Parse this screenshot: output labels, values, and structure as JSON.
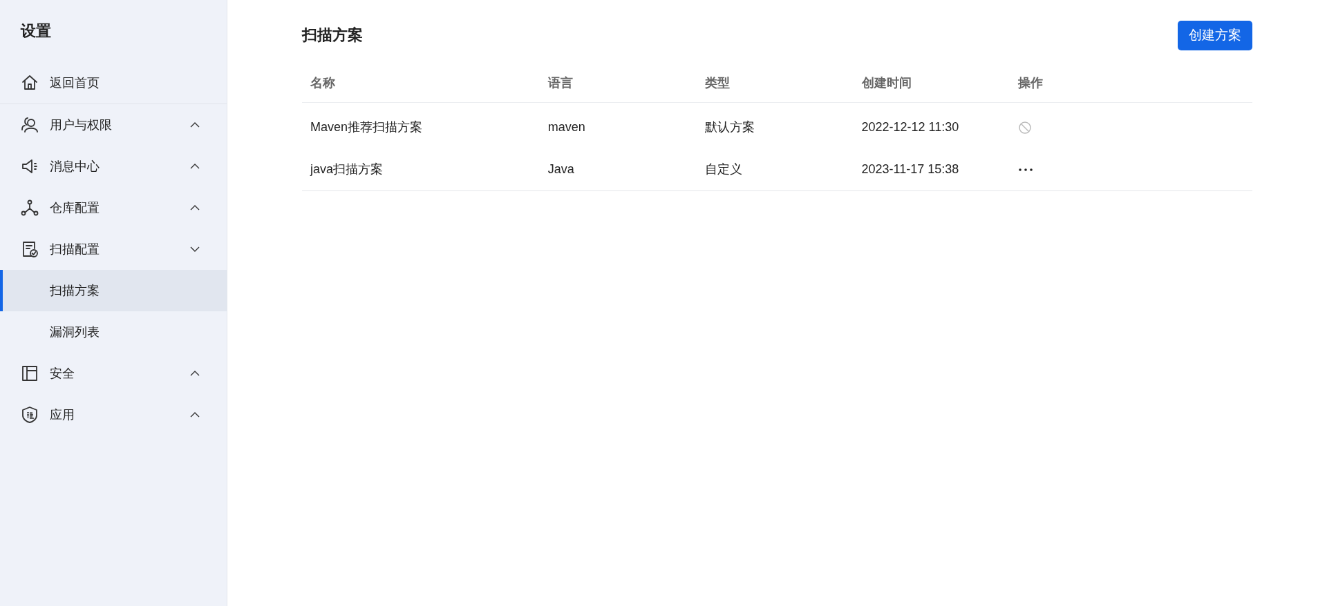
{
  "sidebar": {
    "title": "设置",
    "items": [
      {
        "label": "返回首页",
        "kind": "link"
      },
      {
        "label": "用户与权限",
        "kind": "group",
        "expanded": false
      },
      {
        "label": "消息中心",
        "kind": "group",
        "expanded": false
      },
      {
        "label": "仓库配置",
        "kind": "group",
        "expanded": false
      },
      {
        "label": "扫描配置",
        "kind": "group",
        "expanded": true,
        "children": [
          {
            "label": "扫描方案",
            "selected": true
          },
          {
            "label": "漏洞列表",
            "selected": false
          }
        ]
      },
      {
        "label": "安全",
        "kind": "group",
        "expanded": false
      },
      {
        "label": "应用",
        "kind": "group",
        "expanded": false
      }
    ]
  },
  "page": {
    "title": "扫描方案",
    "create_button": "创建方案"
  },
  "table": {
    "columns": [
      "名称",
      "语言",
      "类型",
      "创建时间",
      "操作"
    ],
    "rows": [
      {
        "cells": [
          "Maven推荐扫描方案",
          "maven",
          "默认方案",
          "2022-12-12 11:30"
        ],
        "kind": "disabled"
      },
      {
        "cells": [
          "java扫描方案",
          "Java",
          "自定义",
          "2023-11-17 15:38"
        ],
        "kind": "more"
      }
    ]
  }
}
